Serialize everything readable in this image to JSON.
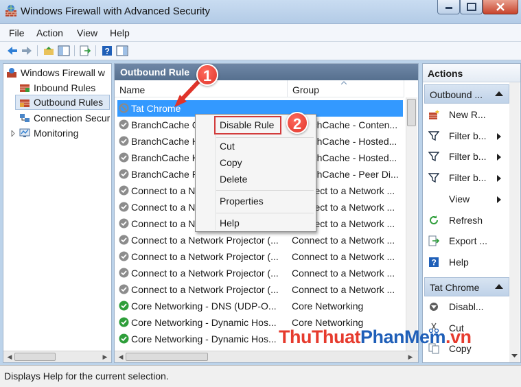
{
  "window": {
    "title": "Windows Firewall with Advanced Security"
  },
  "menu": [
    "File",
    "Action",
    "View",
    "Help"
  ],
  "tree": {
    "root": "Windows Firewall w",
    "items": [
      "Inbound Rules",
      "Outbound Rules",
      "Connection Secur",
      "Monitoring"
    ]
  },
  "center": {
    "title": "Outbound Rule",
    "columns": {
      "name": "Name",
      "group": "Group"
    },
    "rows": [
      {
        "name": "Tat Chrome",
        "group": "",
        "icon": "blocked-icon",
        "selected": true
      },
      {
        "name": "BranchCache C",
        "group": "BranchCache - Conten...",
        "icon": "gray-check-icon"
      },
      {
        "name": "BranchCache H",
        "group": "BranchCache - Hosted...",
        "icon": "gray-check-icon"
      },
      {
        "name": "BranchCache H",
        "group": "BranchCache - Hosted...",
        "icon": "gray-check-icon"
      },
      {
        "name": "BranchCache P",
        "group": "BranchCache - Peer Di...",
        "icon": "gray-check-icon"
      },
      {
        "name": "Connect to a N",
        "group": "Connect to a Network ...",
        "icon": "gray-check-icon"
      },
      {
        "name": "Connect to a N",
        "group": "Connect to a Network ...",
        "icon": "gray-check-icon"
      },
      {
        "name": "Connect to a N",
        "group": "Connect to a Network ...",
        "icon": "gray-check-icon"
      },
      {
        "name": "Connect to a Network Projector (...",
        "group": "Connect to a Network ...",
        "icon": "gray-check-icon"
      },
      {
        "name": "Connect to a Network Projector (...",
        "group": "Connect to a Network ...",
        "icon": "gray-check-icon"
      },
      {
        "name": "Connect to a Network Projector (...",
        "group": "Connect to a Network ...",
        "icon": "gray-check-icon"
      },
      {
        "name": "Connect to a Network Projector (...",
        "group": "Connect to a Network ...",
        "icon": "gray-check-icon"
      },
      {
        "name": "Core Networking - DNS (UDP-O...",
        "group": "Core Networking",
        "icon": "green-check-icon"
      },
      {
        "name": "Core Networking - Dynamic Hos...",
        "group": "Core Networking",
        "icon": "green-check-icon"
      },
      {
        "name": "Core Networking - Dynamic Hos...",
        "group": "",
        "icon": "green-check-icon"
      }
    ]
  },
  "context_menu": {
    "items": [
      "Disable Rule",
      "Cut",
      "Copy",
      "Delete",
      "Properties",
      "Help"
    ]
  },
  "actions": {
    "title": "Actions",
    "section1": "Outbound ...",
    "section1_items": [
      {
        "label": "New R...",
        "icon": "new-rule-icon",
        "submenu": false
      },
      {
        "label": "Filter b...",
        "icon": "filter-icon",
        "submenu": true
      },
      {
        "label": "Filter b...",
        "icon": "filter-icon",
        "submenu": true
      },
      {
        "label": "Filter b...",
        "icon": "filter-icon",
        "submenu": true
      },
      {
        "label": "View",
        "icon": "",
        "submenu": true
      },
      {
        "label": "Refresh",
        "icon": "refresh-icon",
        "submenu": false
      },
      {
        "label": "Export ...",
        "icon": "export-icon",
        "submenu": false
      },
      {
        "label": "Help",
        "icon": "help-icon",
        "submenu": false
      }
    ],
    "section2": "Tat Chrome",
    "section2_items": [
      {
        "label": "Disabl...",
        "icon": "disable-icon"
      },
      {
        "label": "Cut",
        "icon": "cut-icon"
      },
      {
        "label": "Copy",
        "icon": "copy-icon"
      }
    ]
  },
  "status": {
    "text": "Displays Help for the current selection."
  },
  "callouts": [
    "1",
    "2"
  ],
  "watermark": {
    "part1": "ThuThuat",
    "part2": "PhanMem",
    "part3": ".vn"
  },
  "colors": {
    "selection": "#3399ff",
    "callout": "#e0342a",
    "highlight_border": "#d23b3b"
  }
}
